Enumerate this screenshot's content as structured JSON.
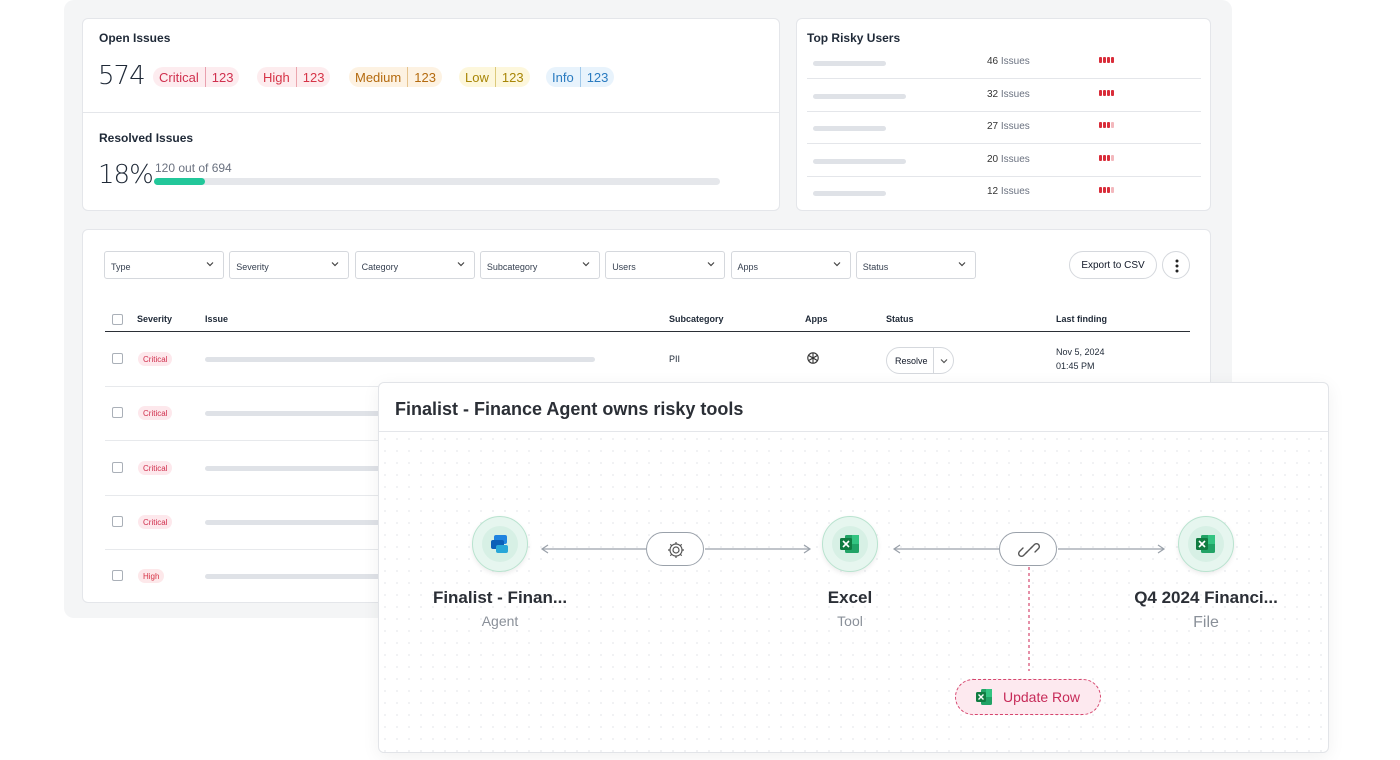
{
  "open_issues": {
    "title": "Open Issues",
    "total": "574",
    "severities": [
      {
        "label": "Critical",
        "count": "123"
      },
      {
        "label": "High",
        "count": "123"
      },
      {
        "label": "Medium",
        "count": "123"
      },
      {
        "label": "Low",
        "count": "123"
      },
      {
        "label": "Info",
        "count": "123"
      }
    ]
  },
  "resolved_issues": {
    "title": "Resolved Issues",
    "percent": "18%",
    "detail": "120 out of 694",
    "progress_fraction": 0.18
  },
  "top_risky_users": {
    "title": "Top Risky Users",
    "issues_label": "Issues",
    "rows": [
      {
        "count": "46",
        "risk_level": 4
      },
      {
        "count": "32",
        "risk_level": 4
      },
      {
        "count": "27",
        "risk_level": 3
      },
      {
        "count": "20",
        "risk_level": 3
      },
      {
        "count": "12",
        "risk_level": 3
      }
    ]
  },
  "filters": [
    "Type",
    "Severity",
    "Category",
    "Subcategory",
    "Users",
    "Apps",
    "Status"
  ],
  "toolbar": {
    "export_label": "Export to CSV",
    "more_icon": "more-vertical-icon"
  },
  "table": {
    "headers": {
      "severity": "Severity",
      "issue": "Issue",
      "subcategory": "Subcategory",
      "apps": "Apps",
      "status": "Status",
      "last_finding": "Last finding"
    },
    "rows": [
      {
        "severity": "Critical",
        "subcategory": "PII",
        "app_icon": "openai-icon",
        "status_action": "Resolve",
        "date": "Nov 5, 2024",
        "time": "01:45 PM"
      },
      {
        "severity": "Critical"
      },
      {
        "severity": "Critical"
      },
      {
        "severity": "Critical"
      },
      {
        "severity": "High"
      }
    ]
  },
  "graph": {
    "title": "Finalist - Finance Agent owns risky tools",
    "nodes": [
      {
        "name": "Finalist - Finan...",
        "type": "Agent",
        "icon": "copilot-studio-icon"
      },
      {
        "name": "Excel",
        "type": "Tool",
        "icon": "excel-icon"
      },
      {
        "name": "Q4 2024 Financi...",
        "type": "File",
        "icon": "excel-icon"
      }
    ],
    "edges": [
      {
        "icon": "gear-icon"
      },
      {
        "icon": "link-icon"
      }
    ],
    "action": {
      "label": "Update Row",
      "icon": "excel-icon"
    }
  },
  "colors": {
    "progress": "#22c79a",
    "risk": "#d92d3a",
    "action_border": "#d6466e",
    "node_bg": "#e6f6ef"
  }
}
